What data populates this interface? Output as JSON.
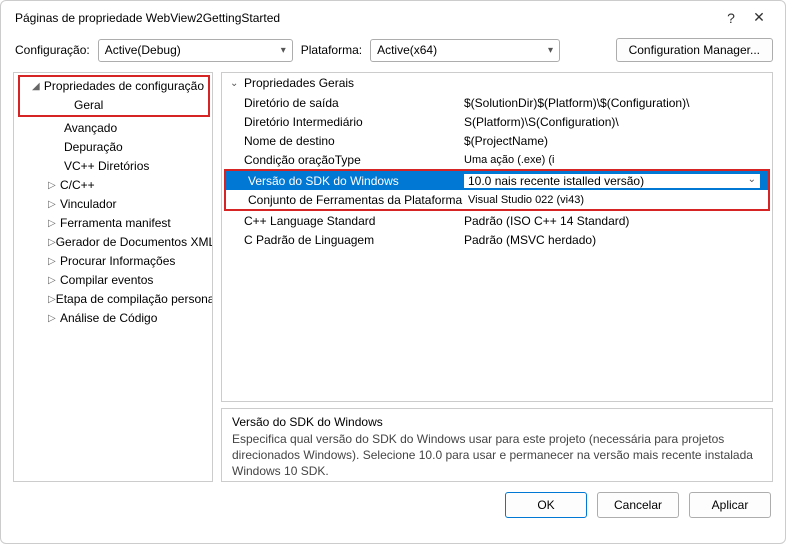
{
  "titlebar": {
    "title": "Páginas de propriedade WebView2GettingStarted"
  },
  "configRow": {
    "configLabel": "Configuração:",
    "configValue": "Active(Debug)",
    "platformLabel": "Plataforma:",
    "platformValue": "Active(x64)",
    "managerBtn": "Configuration Manager..."
  },
  "tree": {
    "root": "Propriedades de configuração",
    "children": [
      "Geral",
      "Avançado",
      "Depuração",
      "VC++ Diretórios"
    ],
    "expandable": [
      "C/C++",
      "Vinculador",
      "Ferramenta manifest",
      "Gerador de Documentos XML",
      "Procurar Informações",
      "Compilar eventos",
      "Etapa de compilação personalizada",
      "Análise de Código"
    ]
  },
  "props": {
    "groupHeader": "Propriedades Gerais",
    "rows": [
      {
        "label": "Diretório de saída",
        "value": "$(SolutionDir)$(Platform)\\$(Configuration)\\"
      },
      {
        "label": "Diretório Intermediário",
        "value": "S(Platform)\\S(Configuration)\\"
      },
      {
        "label": "Nome de destino",
        "value": "$(ProjectName)"
      },
      {
        "label": "Condição oraçãoType",
        "value": "Uma ação (.exe) (i"
      },
      {
        "label": "Versão do SDK do Windows",
        "value": "10.0 nais recente istalled versão)"
      },
      {
        "label": "Conjunto de Ferramentas da Plataforma",
        "value": "Visual Studio 022 (vi43)"
      },
      {
        "label": "C++ Language Standard",
        "value": "Padrão (ISO C++ 14 Standard)"
      },
      {
        "label": "C Padrão de Linguagem",
        "value": "Padrão (MSVC herdado)"
      }
    ]
  },
  "desc": {
    "title": "Versão do SDK do Windows",
    "body": "Especifica qual versão do SDK do Windows usar para este projeto (necessária para projetos direcionados Windows). Selecione 10.0 para usar e permanecer na versão mais recente instalada Windows 10 SDK."
  },
  "footer": {
    "ok": "OK",
    "cancel": "Cancelar",
    "apply": "Aplicar"
  }
}
